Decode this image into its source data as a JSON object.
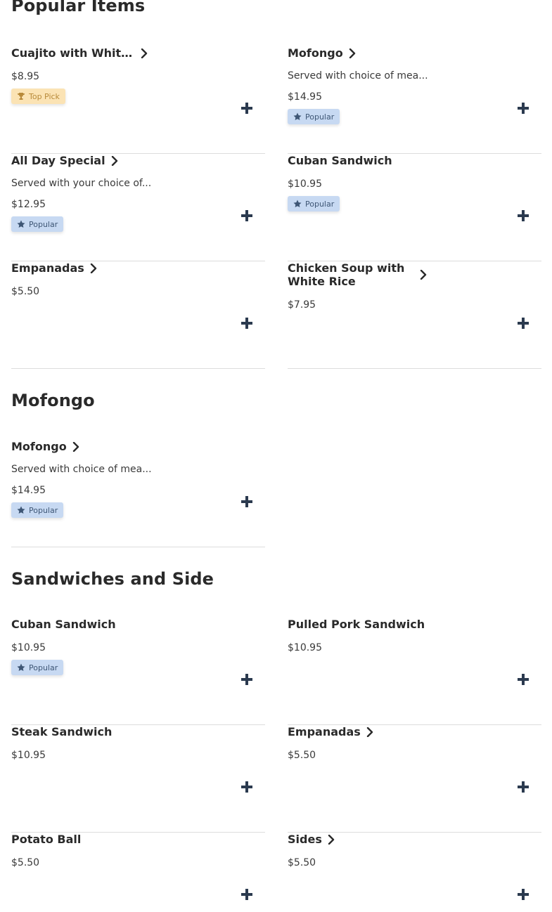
{
  "colors": {
    "text_dark": "#2a2a2a",
    "popular_badge_bg": "#c7d9f2",
    "popular_badge_text": "#3e5675",
    "toppick_badge_bg": "#fbe3b4",
    "toppick_badge_text": "#b88a3a",
    "add_icon": "#2b3a4f"
  },
  "sections": [
    {
      "title": "Popular Items",
      "items": [
        {
          "name": "Cuajito with White...",
          "chevron": true,
          "description": "",
          "price": "$8.95",
          "badge": "Top Pick"
        },
        {
          "name": "Mofongo",
          "chevron": true,
          "description": "Served with choice of mea...",
          "price": "$14.95",
          "badge": "Popular"
        },
        {
          "name": "All Day Special",
          "chevron": true,
          "description": "Served with your choice of...",
          "price": "$12.95",
          "badge": "Popular"
        },
        {
          "name": "Cuban Sandwich",
          "chevron": false,
          "description": "",
          "price": "$10.95",
          "badge": "Popular"
        },
        {
          "name": "Empanadas",
          "chevron": true,
          "description": "",
          "price": "$5.50",
          "badge": ""
        },
        {
          "name": "Chicken Soup with White Rice",
          "chevron": true,
          "description": "",
          "price": "$7.95",
          "badge": ""
        }
      ]
    },
    {
      "title": "Mofongo",
      "items": [
        {
          "name": "Mofongo",
          "chevron": true,
          "description": "Served with choice of mea...",
          "price": "$14.95",
          "badge": "Popular"
        }
      ]
    },
    {
      "title": "Sandwiches and Side",
      "items": [
        {
          "name": "Cuban Sandwich",
          "chevron": false,
          "description": "",
          "price": "$10.95",
          "badge": "Popular"
        },
        {
          "name": "Pulled Pork Sandwich",
          "chevron": false,
          "description": "",
          "price": "$10.95",
          "badge": ""
        },
        {
          "name": "Steak Sandwich",
          "chevron": false,
          "description": "",
          "price": "$10.95",
          "badge": ""
        },
        {
          "name": "Empanadas",
          "chevron": true,
          "description": "",
          "price": "$5.50",
          "badge": ""
        },
        {
          "name": "Potato Ball",
          "chevron": false,
          "description": "",
          "price": "$5.50",
          "badge": ""
        },
        {
          "name": "Sides",
          "chevron": true,
          "description": "",
          "price": "$5.50",
          "badge": ""
        }
      ]
    }
  ],
  "icons": {
    "chevron": "chevron-right-icon",
    "add": "plus-icon",
    "popular": "star-icon",
    "toppick": "trophy-icon"
  }
}
